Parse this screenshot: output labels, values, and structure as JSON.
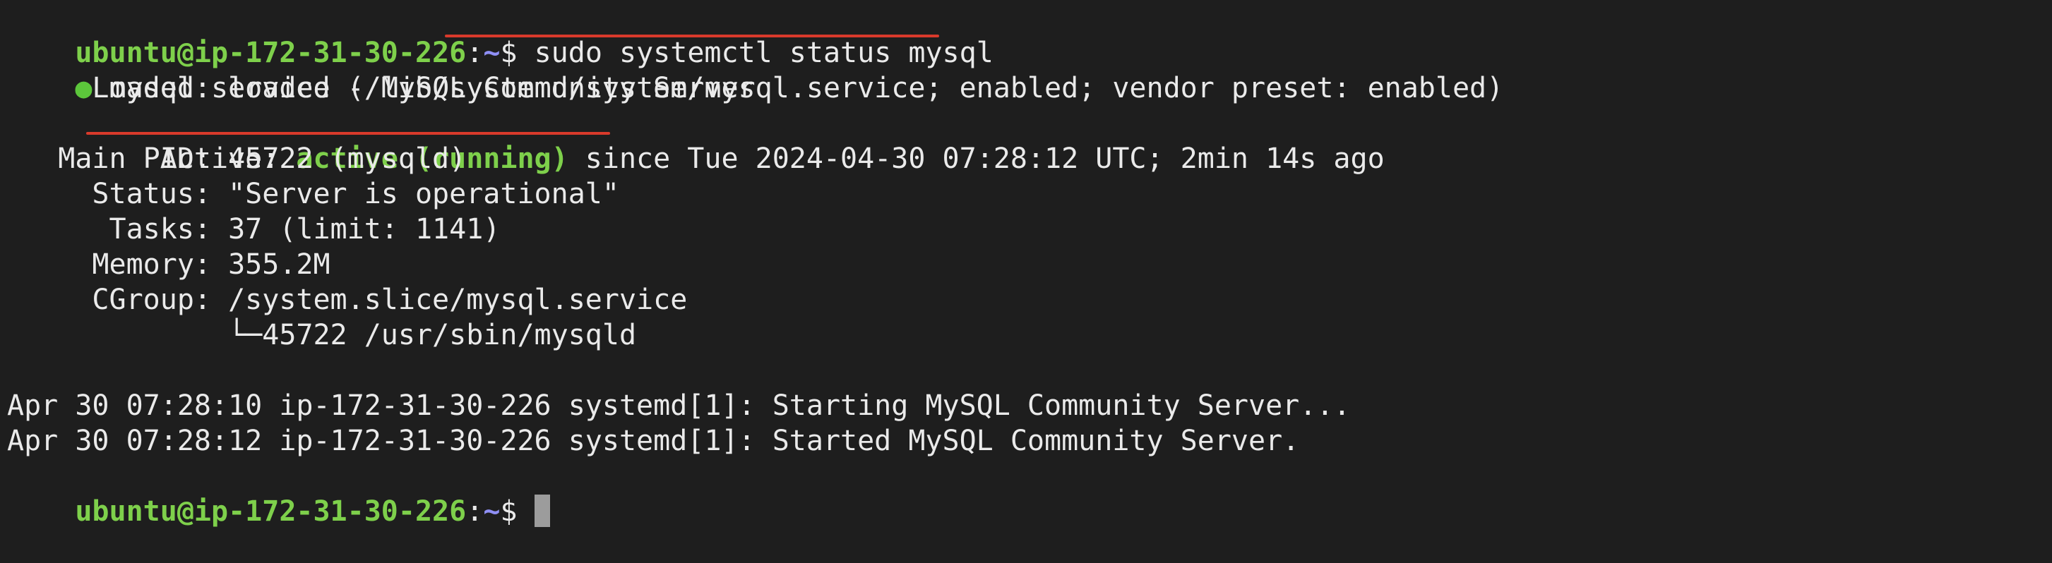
{
  "prompt": {
    "user_host": "ubuntu@ip-172-31-30-226",
    "separator": ":",
    "cwd": "~",
    "symbol": "$ "
  },
  "command": "sudo systemctl status mysql",
  "service": {
    "status_dot": "●",
    "header": "mysql.service - MySQL Community Server",
    "loaded": "     Loaded: loaded (/lib/systemd/system/mysql.service; enabled; vendor preset: enabled)",
    "active_label": "     Active: ",
    "active_state": "active (running)",
    "active_since": " since Tue 2024-04-30 07:28:12 UTC; 2min 14s ago",
    "main_pid": "   Main PID: 45722 (mysqld)",
    "status": "     Status: \"Server is operational\"",
    "tasks": "      Tasks: 37 (limit: 1141)",
    "memory": "     Memory: 355.2M",
    "cgroup": "     CGroup: /system.slice/mysql.service",
    "cgroup_child": "             └─45722 /usr/sbin/mysqld"
  },
  "log": [
    "Apr 30 07:28:10 ip-172-31-30-226 systemd[1]: Starting MySQL Community Server...",
    "Apr 30 07:28:12 ip-172-31-30-226 systemd[1]: Started MySQL Community Server."
  ],
  "colors": {
    "background": "#1e1e1e",
    "text": "#eaeaea",
    "prompt_green": "#7ed04b",
    "prompt_blue": "#8f8ff5",
    "annotation_red": "#d93a2b"
  }
}
